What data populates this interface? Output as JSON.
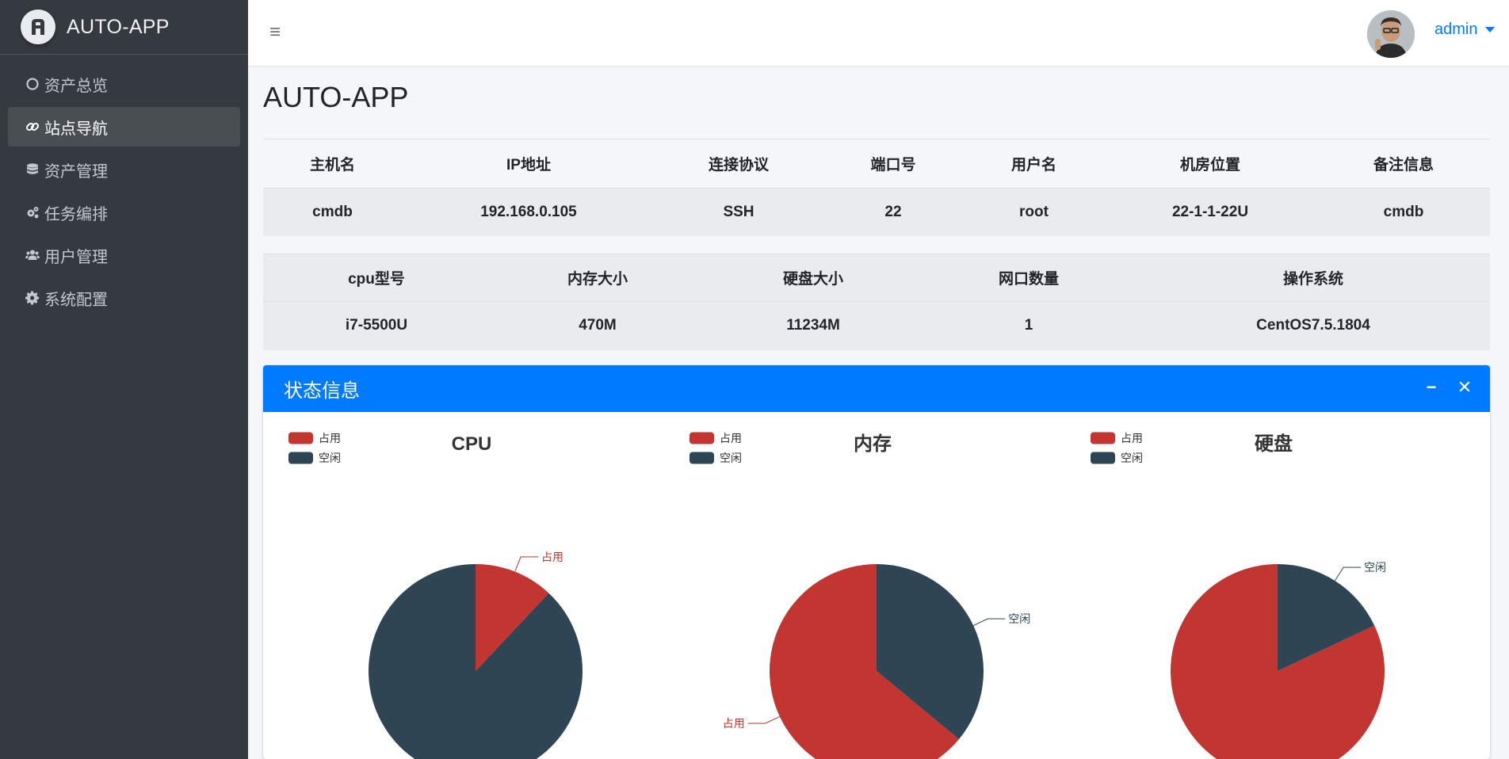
{
  "app": {
    "name": "AUTO-APP"
  },
  "sidebar": {
    "items": [
      {
        "label": "资产总览",
        "icon": "circle-icon"
      },
      {
        "label": "站点导航",
        "icon": "link-icon",
        "active": true
      },
      {
        "label": "资产管理",
        "icon": "database-icon"
      },
      {
        "label": "任务编排",
        "icon": "cogs-icon"
      },
      {
        "label": "用户管理",
        "icon": "users-icon"
      },
      {
        "label": "系统配置",
        "icon": "gear-icon"
      }
    ]
  },
  "header": {
    "menu_icon": "≡",
    "user": "admin"
  },
  "page": {
    "title": "AUTO-APP"
  },
  "host_table": {
    "headers": [
      "主机名",
      "IP地址",
      "连接协议",
      "端口号",
      "用户名",
      "机房位置",
      "备注信息"
    ],
    "row": [
      "cmdb",
      "192.168.0.105",
      "SSH",
      "22",
      "root",
      "22-1-1-22U",
      "cmdb"
    ]
  },
  "hw_table": {
    "headers": [
      "cpu型号",
      "内存大小",
      "硬盘大小",
      "网口数量",
      "操作系统"
    ],
    "row": [
      "i7-5500U",
      "470M",
      "11234M",
      "1",
      "CentOS7.5.1804"
    ]
  },
  "status_card": {
    "title": "状态信息",
    "minimize_label": "−",
    "close_label": "✕"
  },
  "colors": {
    "used": "#c23531",
    "free": "#2f4554",
    "accent": "#007bff",
    "sidebar": "#343a40"
  },
  "chart_data": [
    {
      "type": "pie",
      "title": "CPU",
      "legend": [
        "占用",
        "空闲"
      ],
      "slices": [
        {
          "name": "占用",
          "value": 12
        },
        {
          "name": "空闲",
          "value": 88
        }
      ]
    },
    {
      "type": "pie",
      "title": "内存",
      "legend": [
        "占用",
        "空闲"
      ],
      "slices": [
        {
          "name": "占用",
          "value": 64
        },
        {
          "name": "空闲",
          "value": 36
        }
      ]
    },
    {
      "type": "pie",
      "title": "硬盘",
      "legend": [
        "占用",
        "空闲"
      ],
      "slices": [
        {
          "name": "占用",
          "value": 82
        },
        {
          "name": "空闲",
          "value": 18
        }
      ]
    }
  ]
}
